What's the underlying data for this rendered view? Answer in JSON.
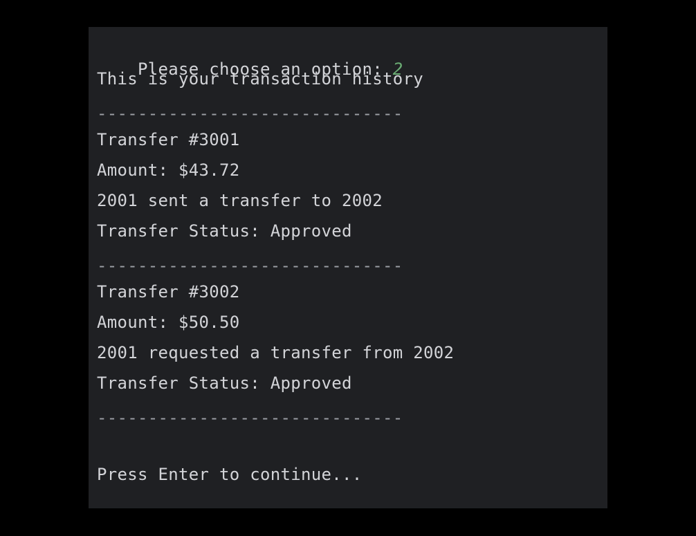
{
  "console": {
    "prompt_label": "Please choose an option: ",
    "prompt_input": "2",
    "history_heading": "This is your transaction history",
    "separator": "------------------------------",
    "transfers": [
      {
        "id_line": "Transfer #3001",
        "amount_line": "Amount: $43.72",
        "description_line": "2001 sent a transfer to 2002",
        "status_line": "Transfer Status: Approved"
      },
      {
        "id_line": "Transfer #3002",
        "amount_line": "Amount: $50.50",
        "description_line": "2001 requested a transfer from 2002",
        "status_line": "Transfer Status: Approved"
      }
    ],
    "continue_prompt": "Press Enter to continue..."
  },
  "colors": {
    "background": "#000000",
    "console_background": "#1f2023",
    "text": "#d3d4d8",
    "user_input": "#6aab73"
  }
}
